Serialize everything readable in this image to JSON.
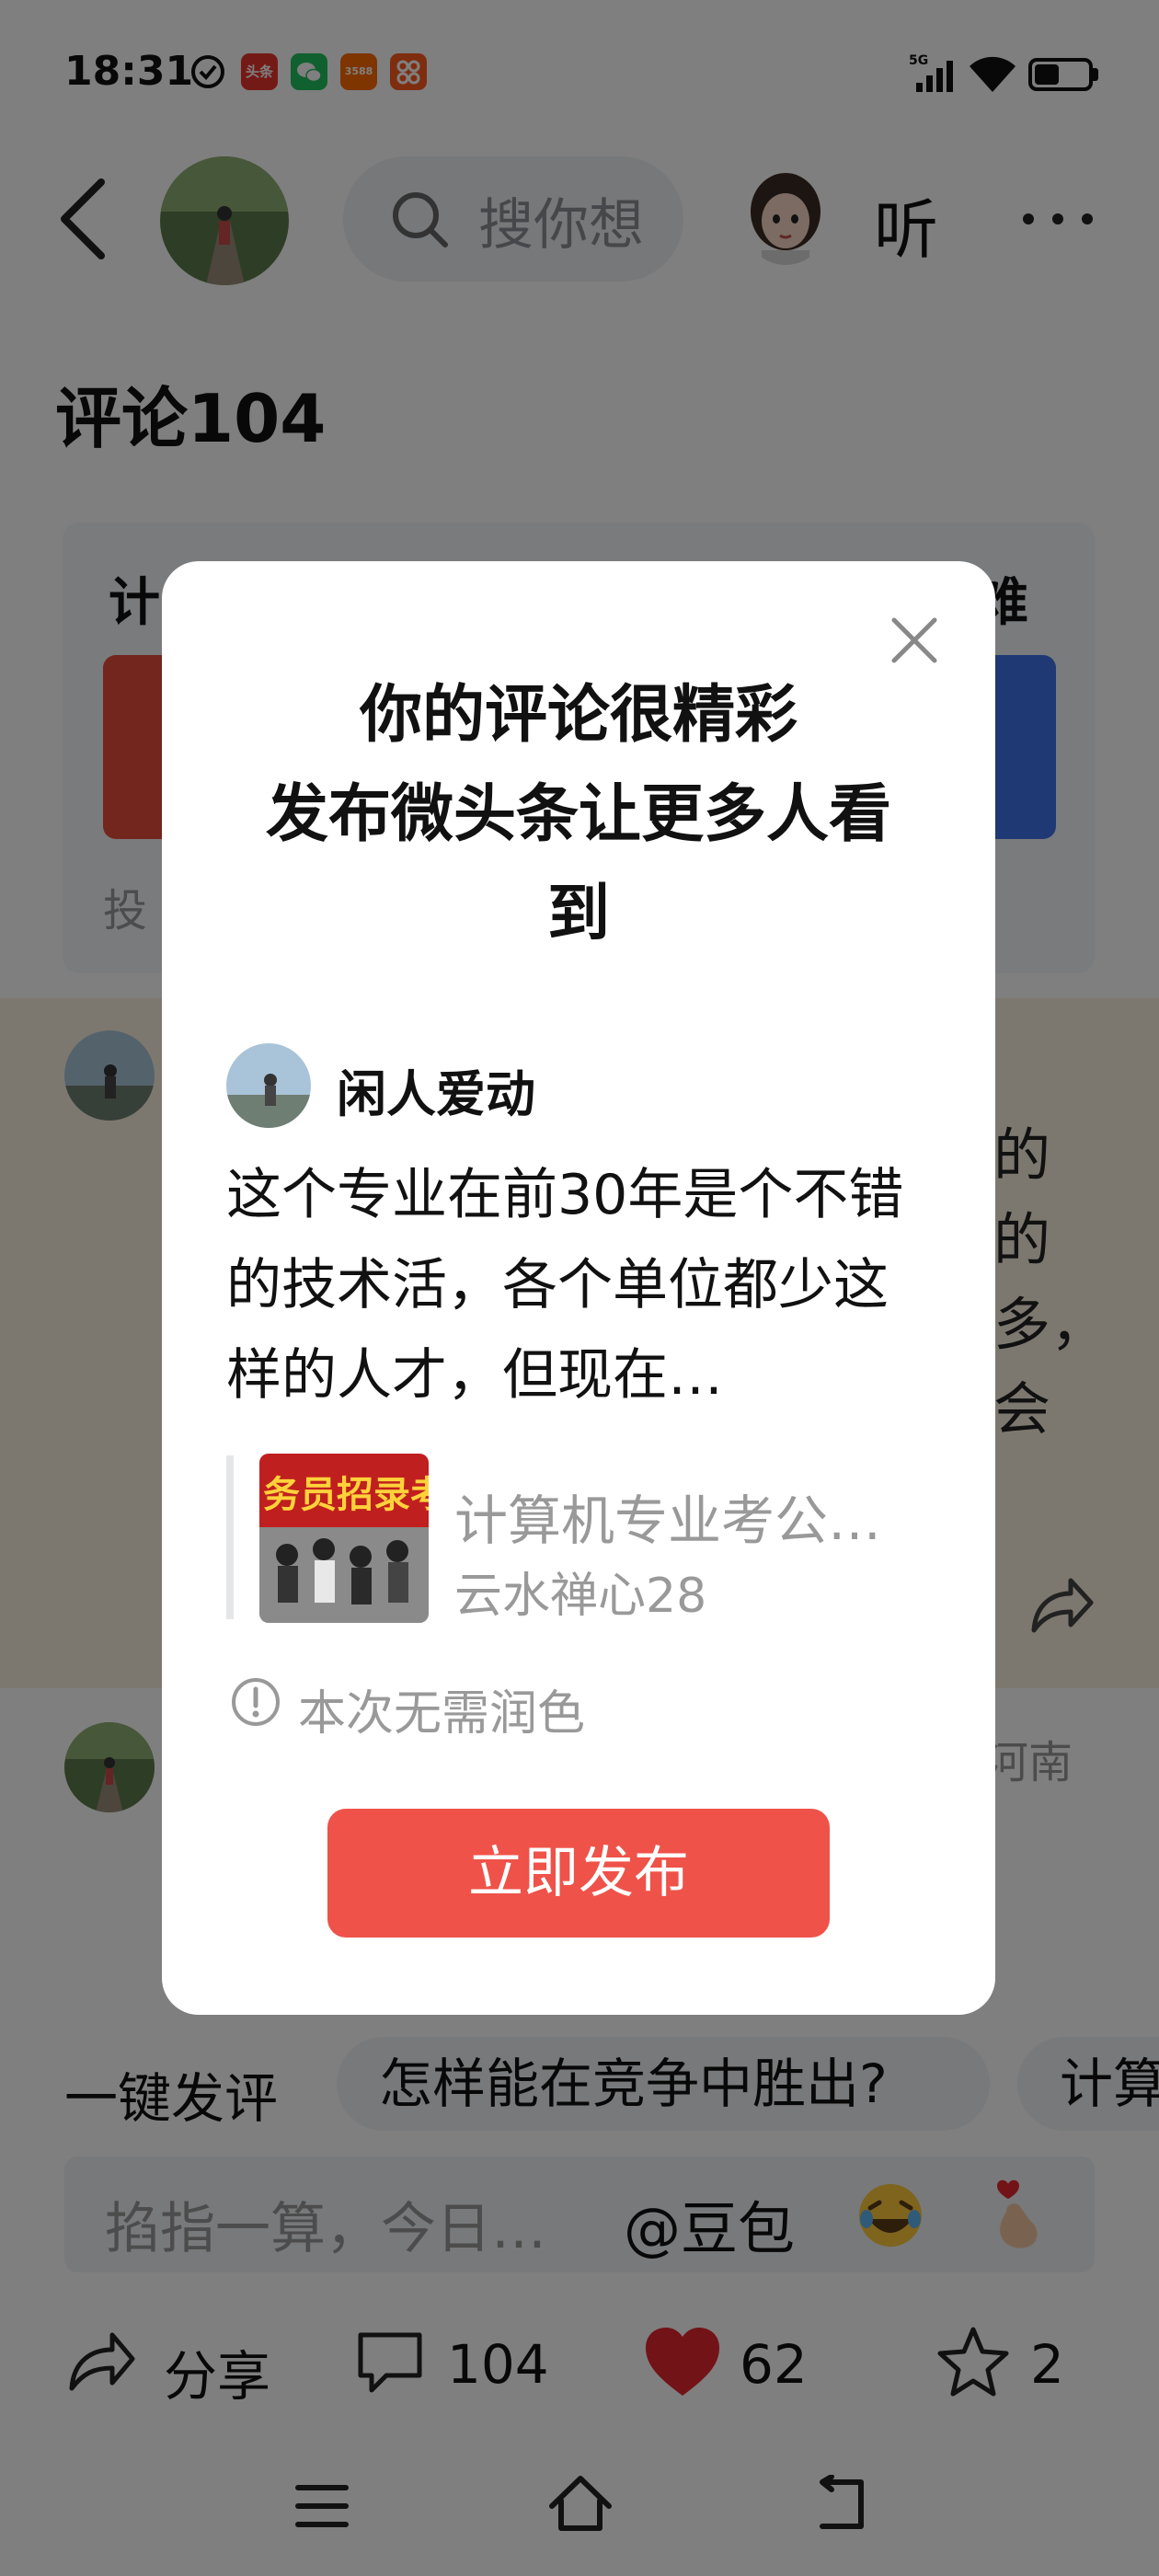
{
  "status_bar": {
    "time": "18:31",
    "network": "5G",
    "app_icons": [
      "check-circle-icon",
      "toutiao-app-icon",
      "wechat-app-icon",
      "taobao-app-icon",
      "app-icon"
    ],
    "app_icon_labels": [
      "头条",
      "3588"
    ]
  },
  "header": {
    "back_icon": "chevron-left-icon",
    "search_placeholder": "搜你想",
    "listen_label": "听",
    "more_icon": "more-horizontal-icon"
  },
  "comments": {
    "title": "评论104"
  },
  "poll_card": {
    "question_left": "计",
    "question_right": "难",
    "footer": "投"
  },
  "background_comment": {
    "text_right": [
      "的",
      "的",
      "多，",
      "会"
    ],
    "second_location": "河南"
  },
  "suggestions": {
    "label": "一键发评",
    "chips": [
      "怎样能在竞争中胜出?",
      "计算"
    ]
  },
  "comment_input": {
    "placeholder": "掐指一算，今日…",
    "mention": "@豆包"
  },
  "actions": {
    "share_label": "分享",
    "comment_count": "104",
    "like_count": "62",
    "favorite_count": "2"
  },
  "modal": {
    "title_lines": [
      "你的评论很精彩",
      "发布微头条让更多人看",
      "到"
    ],
    "username": "闲人爱动",
    "comment_text": "这个专业在前30年是个不错的技术活，各个单位都少这样的人才，但现在…",
    "article_title": "计算机专业考公…",
    "article_author": "云水禅心28",
    "thumbnail_text": "务员招录考",
    "note": "本次无需润色",
    "publish_button": "立即发布"
  },
  "colors": {
    "accent_red": "#ef5249",
    "like_red": "#e5262f",
    "poll_blue": "#3f73e8",
    "highlight_band": "#fbf1df"
  }
}
